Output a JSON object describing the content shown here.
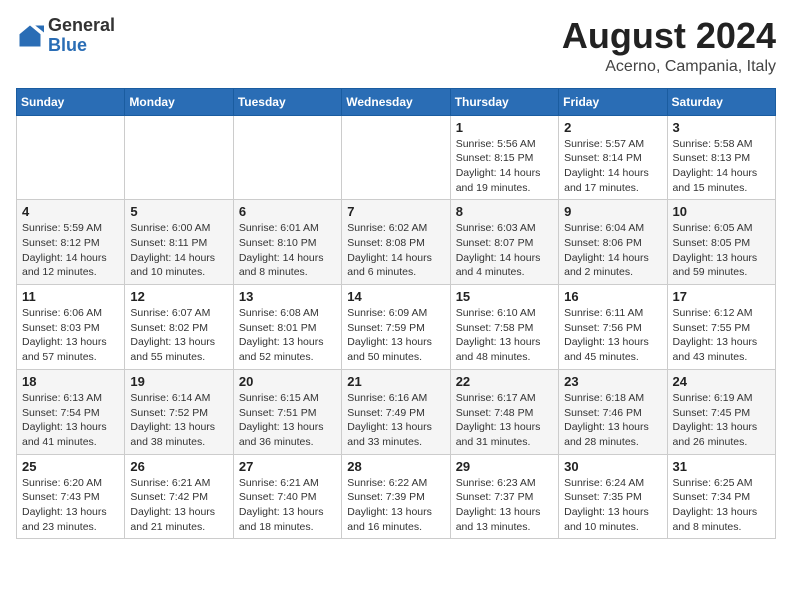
{
  "header": {
    "logo_general": "General",
    "logo_blue": "Blue",
    "month_title": "August 2024",
    "subtitle": "Acerno, Campania, Italy"
  },
  "weekdays": [
    "Sunday",
    "Monday",
    "Tuesday",
    "Wednesday",
    "Thursday",
    "Friday",
    "Saturday"
  ],
  "weeks": [
    [
      {
        "day": "",
        "info": ""
      },
      {
        "day": "",
        "info": ""
      },
      {
        "day": "",
        "info": ""
      },
      {
        "day": "",
        "info": ""
      },
      {
        "day": "1",
        "info": "Sunrise: 5:56 AM\nSunset: 8:15 PM\nDaylight: 14 hours\nand 19 minutes."
      },
      {
        "day": "2",
        "info": "Sunrise: 5:57 AM\nSunset: 8:14 PM\nDaylight: 14 hours\nand 17 minutes."
      },
      {
        "day": "3",
        "info": "Sunrise: 5:58 AM\nSunset: 8:13 PM\nDaylight: 14 hours\nand 15 minutes."
      }
    ],
    [
      {
        "day": "4",
        "info": "Sunrise: 5:59 AM\nSunset: 8:12 PM\nDaylight: 14 hours\nand 12 minutes."
      },
      {
        "day": "5",
        "info": "Sunrise: 6:00 AM\nSunset: 8:11 PM\nDaylight: 14 hours\nand 10 minutes."
      },
      {
        "day": "6",
        "info": "Sunrise: 6:01 AM\nSunset: 8:10 PM\nDaylight: 14 hours\nand 8 minutes."
      },
      {
        "day": "7",
        "info": "Sunrise: 6:02 AM\nSunset: 8:08 PM\nDaylight: 14 hours\nand 6 minutes."
      },
      {
        "day": "8",
        "info": "Sunrise: 6:03 AM\nSunset: 8:07 PM\nDaylight: 14 hours\nand 4 minutes."
      },
      {
        "day": "9",
        "info": "Sunrise: 6:04 AM\nSunset: 8:06 PM\nDaylight: 14 hours\nand 2 minutes."
      },
      {
        "day": "10",
        "info": "Sunrise: 6:05 AM\nSunset: 8:05 PM\nDaylight: 13 hours\nand 59 minutes."
      }
    ],
    [
      {
        "day": "11",
        "info": "Sunrise: 6:06 AM\nSunset: 8:03 PM\nDaylight: 13 hours\nand 57 minutes."
      },
      {
        "day": "12",
        "info": "Sunrise: 6:07 AM\nSunset: 8:02 PM\nDaylight: 13 hours\nand 55 minutes."
      },
      {
        "day": "13",
        "info": "Sunrise: 6:08 AM\nSunset: 8:01 PM\nDaylight: 13 hours\nand 52 minutes."
      },
      {
        "day": "14",
        "info": "Sunrise: 6:09 AM\nSunset: 7:59 PM\nDaylight: 13 hours\nand 50 minutes."
      },
      {
        "day": "15",
        "info": "Sunrise: 6:10 AM\nSunset: 7:58 PM\nDaylight: 13 hours\nand 48 minutes."
      },
      {
        "day": "16",
        "info": "Sunrise: 6:11 AM\nSunset: 7:56 PM\nDaylight: 13 hours\nand 45 minutes."
      },
      {
        "day": "17",
        "info": "Sunrise: 6:12 AM\nSunset: 7:55 PM\nDaylight: 13 hours\nand 43 minutes."
      }
    ],
    [
      {
        "day": "18",
        "info": "Sunrise: 6:13 AM\nSunset: 7:54 PM\nDaylight: 13 hours\nand 41 minutes."
      },
      {
        "day": "19",
        "info": "Sunrise: 6:14 AM\nSunset: 7:52 PM\nDaylight: 13 hours\nand 38 minutes."
      },
      {
        "day": "20",
        "info": "Sunrise: 6:15 AM\nSunset: 7:51 PM\nDaylight: 13 hours\nand 36 minutes."
      },
      {
        "day": "21",
        "info": "Sunrise: 6:16 AM\nSunset: 7:49 PM\nDaylight: 13 hours\nand 33 minutes."
      },
      {
        "day": "22",
        "info": "Sunrise: 6:17 AM\nSunset: 7:48 PM\nDaylight: 13 hours\nand 31 minutes."
      },
      {
        "day": "23",
        "info": "Sunrise: 6:18 AM\nSunset: 7:46 PM\nDaylight: 13 hours\nand 28 minutes."
      },
      {
        "day": "24",
        "info": "Sunrise: 6:19 AM\nSunset: 7:45 PM\nDaylight: 13 hours\nand 26 minutes."
      }
    ],
    [
      {
        "day": "25",
        "info": "Sunrise: 6:20 AM\nSunset: 7:43 PM\nDaylight: 13 hours\nand 23 minutes."
      },
      {
        "day": "26",
        "info": "Sunrise: 6:21 AM\nSunset: 7:42 PM\nDaylight: 13 hours\nand 21 minutes."
      },
      {
        "day": "27",
        "info": "Sunrise: 6:21 AM\nSunset: 7:40 PM\nDaylight: 13 hours\nand 18 minutes."
      },
      {
        "day": "28",
        "info": "Sunrise: 6:22 AM\nSunset: 7:39 PM\nDaylight: 13 hours\nand 16 minutes."
      },
      {
        "day": "29",
        "info": "Sunrise: 6:23 AM\nSunset: 7:37 PM\nDaylight: 13 hours\nand 13 minutes."
      },
      {
        "day": "30",
        "info": "Sunrise: 6:24 AM\nSunset: 7:35 PM\nDaylight: 13 hours\nand 10 minutes."
      },
      {
        "day": "31",
        "info": "Sunrise: 6:25 AM\nSunset: 7:34 PM\nDaylight: 13 hours\nand 8 minutes."
      }
    ]
  ]
}
